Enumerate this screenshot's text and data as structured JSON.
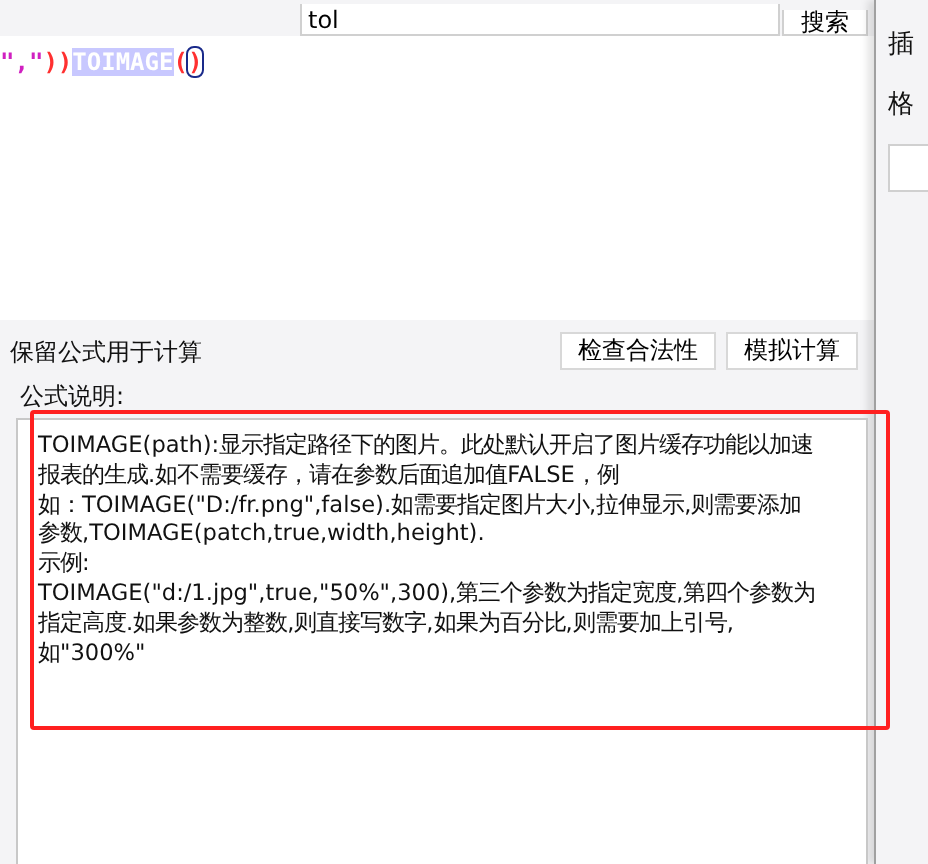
{
  "search": {
    "value": "tol",
    "button": "搜索"
  },
  "editor": {
    "tokens": [
      {
        "text": "\",\"",
        "kind": "string"
      },
      {
        "text": "))",
        "kind": "paren"
      },
      {
        "text": "TOIMAGE",
        "kind": "selection"
      },
      {
        "text": "(",
        "kind": "paren"
      },
      {
        "text": ")",
        "kind": "cursor"
      }
    ]
  },
  "side_panel": {
    "labels": [
      "插",
      "格"
    ]
  },
  "options": {
    "keep_formula_label": "保留公式用于计算",
    "buttons": [
      "检查合法性",
      "模拟计算"
    ]
  },
  "description": {
    "label": "公式说明:",
    "lines": [
      "TOIMAGE(path):显示指定路径下的图片。此处默认开启了图片缓存功能以加速",
      "报表的生成.如不需要缓存，请在参数后面追加值FALSE，例",
      "如：TOIMAGE(\"D:/fr.png\",false).如需要指定图片大小,拉伸显示,则需要添加",
      "参数,TOIMAGE(patch,true,width,height).",
      "示例:",
      "TOIMAGE(\"d:/1.jpg\",true,\"50%\",300),第三个参数为指定宽度,第四个参数为",
      "指定高度.如果参数为整数,则直接写数字,如果为百分比,则需要加上引号,",
      "如\"300%\""
    ],
    "highlighted": true
  }
}
